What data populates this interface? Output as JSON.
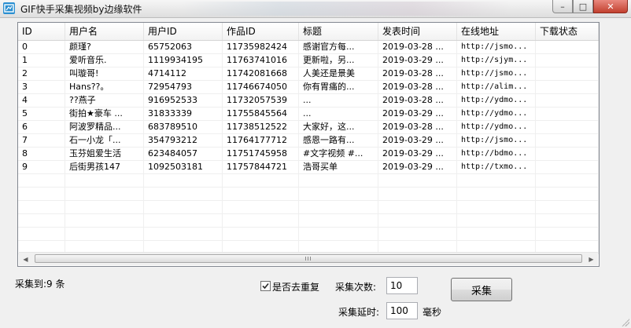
{
  "window": {
    "title": "GIF快手采集视频by边缘软件",
    "min_glyph": "–",
    "max_glyph": "□",
    "close_glyph": "✕"
  },
  "table": {
    "columns": [
      "ID",
      "用户名",
      "用户ID",
      "作品ID",
      "标题",
      "发表时间",
      "在线地址",
      "下载状态"
    ],
    "rows": [
      [
        "0",
        "颜瑾?",
        "65752063",
        "11735982424",
        "感谢官方每...",
        "2019-03-28 ...",
        "http://jsmo...",
        ""
      ],
      [
        "1",
        "爱听音乐.",
        "1119934195",
        "11763741016",
        "更新啦，另...",
        "2019-03-29 ...",
        "http://sjym...",
        ""
      ],
      [
        "2",
        "叫璇哥!",
        "4714112",
        "11742081668",
        "人美还是景美",
        "2019-03-28 ...",
        "http://jsmo...",
        ""
      ],
      [
        "3",
        "Hans??。",
        "72954793",
        "11746674050",
        "你有胃痛的...",
        "2019-03-28 ...",
        "http://alim...",
        ""
      ],
      [
        "4",
        "??燕子",
        "916952533",
        "11732057539",
        "...",
        "2019-03-28 ...",
        "http://ydmo...",
        ""
      ],
      [
        "5",
        "街拍★豪车 ...",
        "31833339",
        "11755845564",
        "...",
        "2019-03-29 ...",
        "http://ydmo...",
        ""
      ],
      [
        "6",
        "阿波罗精品...",
        "683789510",
        "11738512522",
        "大家好，这...",
        "2019-03-28 ...",
        "http://ydmo...",
        ""
      ],
      [
        "7",
        "石一小龙「...",
        "354793212",
        "11764177712",
        "感恩一路有...",
        "2019-03-29 ...",
        "http://jsmo...",
        ""
      ],
      [
        "8",
        "玉芬姐爱生活",
        "623484057",
        "11751745958",
        "#文字视频 #...",
        "2019-03-29 ...",
        "http://bdmo...",
        ""
      ],
      [
        "9",
        "后街男孩147",
        "1092503181",
        "11757844721",
        "浩哥买单",
        "2019-03-29 ...",
        "http://txmo...",
        ""
      ]
    ]
  },
  "status": {
    "collected": "采集到:9 条"
  },
  "controls": {
    "dedupe_label": "是否去重复",
    "dedupe_checked": true,
    "count_label": "采集次数:",
    "count_value": "10",
    "delay_label": "采集延时:",
    "delay_value": "100",
    "delay_unit": "毫秒",
    "collect_button": "采集"
  }
}
